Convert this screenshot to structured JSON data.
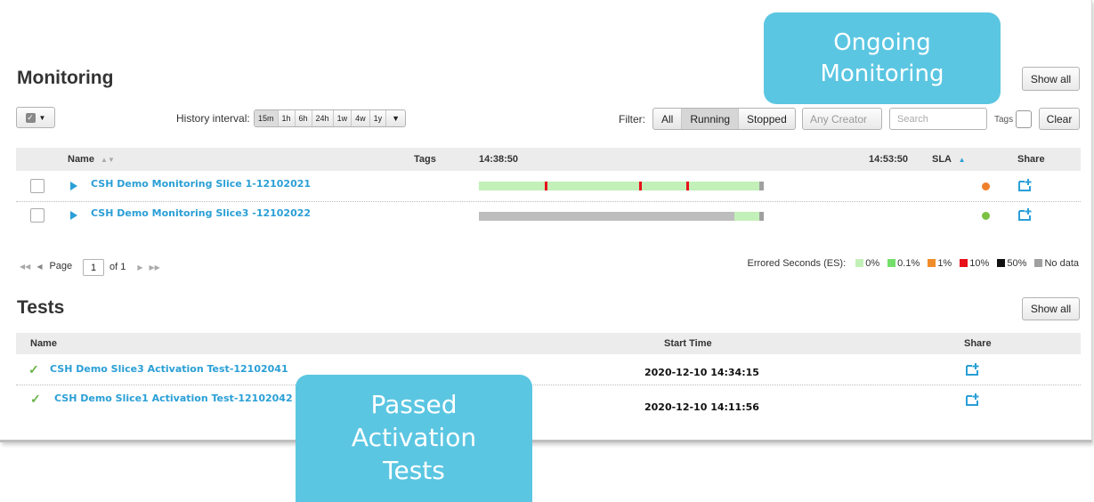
{
  "monitoring": {
    "title": "Monitoring",
    "show_all": "Show all",
    "history_label": "History interval:",
    "history_options": [
      "15m",
      "1h",
      "6h",
      "24h",
      "1w",
      "4w",
      "1y"
    ],
    "history_selected": "15m",
    "filter_label": "Filter:",
    "filter_options": [
      "All",
      "Running",
      "Stopped"
    ],
    "filter_selected": "Running",
    "creator_select": "Any Creator",
    "search_placeholder": "Search",
    "tags_label": "Tags",
    "clear": "Clear",
    "columns": {
      "name": "Name",
      "tags": "Tags",
      "time_start": "14:38:50",
      "time_end": "14:53:50",
      "sla": "SLA",
      "share": "Share"
    },
    "rows": [
      {
        "name": "CSH Demo Monitoring Slice 1-12102021",
        "sla_color": "#f07f2a"
      },
      {
        "name": "CSH Demo Monitoring Slice3 -12102022",
        "sla_color": "#7cc142"
      }
    ],
    "pager": {
      "page_label": "Page",
      "page": "1",
      "of": "of 1"
    },
    "legend": {
      "label": "Errored Seconds (ES):",
      "items": [
        {
          "label": "0%",
          "color": "#c2f0b8"
        },
        {
          "label": "0.1%",
          "color": "#74e06b"
        },
        {
          "label": "1%",
          "color": "#f08c2a"
        },
        {
          "label": "10%",
          "color": "#e8101a"
        },
        {
          "label": "50%",
          "color": "#111111"
        },
        {
          "label": "No data",
          "color": "#a0a0a0"
        }
      ]
    }
  },
  "tests": {
    "title": "Tests",
    "show_all": "Show all",
    "columns": {
      "name": "Name",
      "start_time": "Start Time",
      "share": "Share"
    },
    "rows": [
      {
        "name": "CSH Demo Slice3 Activation Test-12102041",
        "start_time": "2020-12-10  14:34:15",
        "status": "passed"
      },
      {
        "name": "CSH Demo Slice1 Activation Test-12102042",
        "start_time": "2020-12-10 14:11:56",
        "status": "passed"
      }
    ]
  },
  "callouts": {
    "ongoing": [
      "Ongoing",
      "Monitoring"
    ],
    "passed": [
      "Passed",
      "Activation",
      "Tests"
    ]
  },
  "colors": {
    "accent": "#2a9fd6",
    "callout": "#5bc6e2",
    "bar_ok": "#c2f0b8",
    "bar_nodata": "#a0a0a0",
    "bar_error": "#e8101a"
  }
}
